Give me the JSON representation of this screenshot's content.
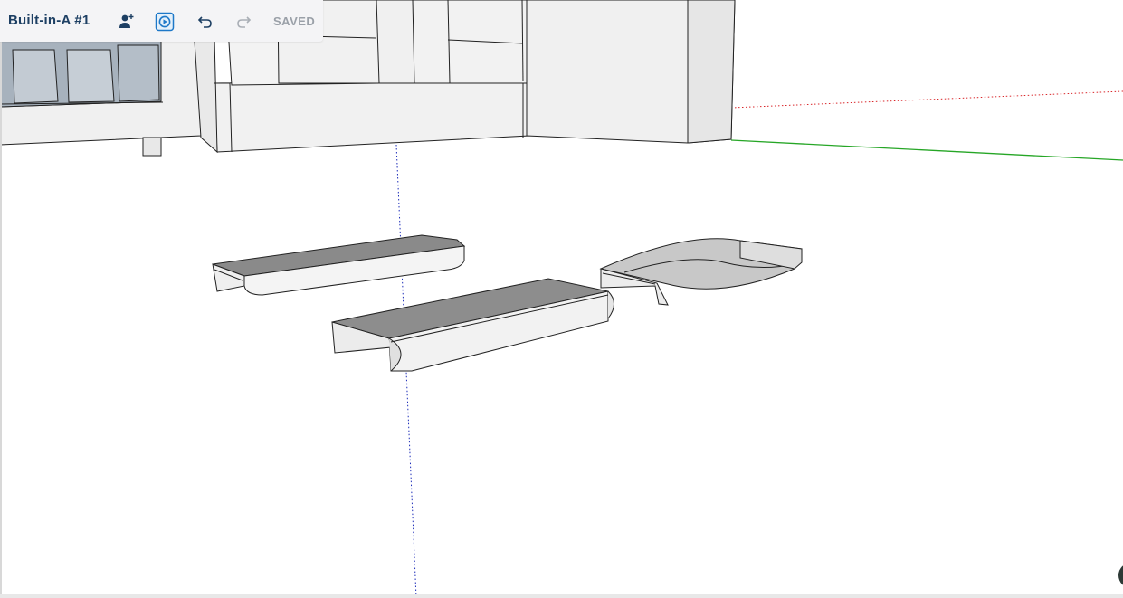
{
  "toolbar": {
    "title": "Built-in-A #1",
    "status": "SAVED",
    "buttons": [
      {
        "name": "add-collaborator",
        "icon": "add-person-icon"
      },
      {
        "name": "present-scene",
        "icon": "play-circle-icon"
      },
      {
        "name": "undo",
        "icon": "undo-icon"
      },
      {
        "name": "redo",
        "icon": "redo-icon",
        "disabled": true
      }
    ]
  },
  "colors": {
    "title": "#1d3f63",
    "icon": "#1d3f63",
    "disabled_icon": "#a9aeb5",
    "toolbar_bg": "#f4f4f6",
    "axis_red": "#d9262a",
    "axis_green": "#26a626",
    "axis_blue": "#1b2bb8"
  }
}
